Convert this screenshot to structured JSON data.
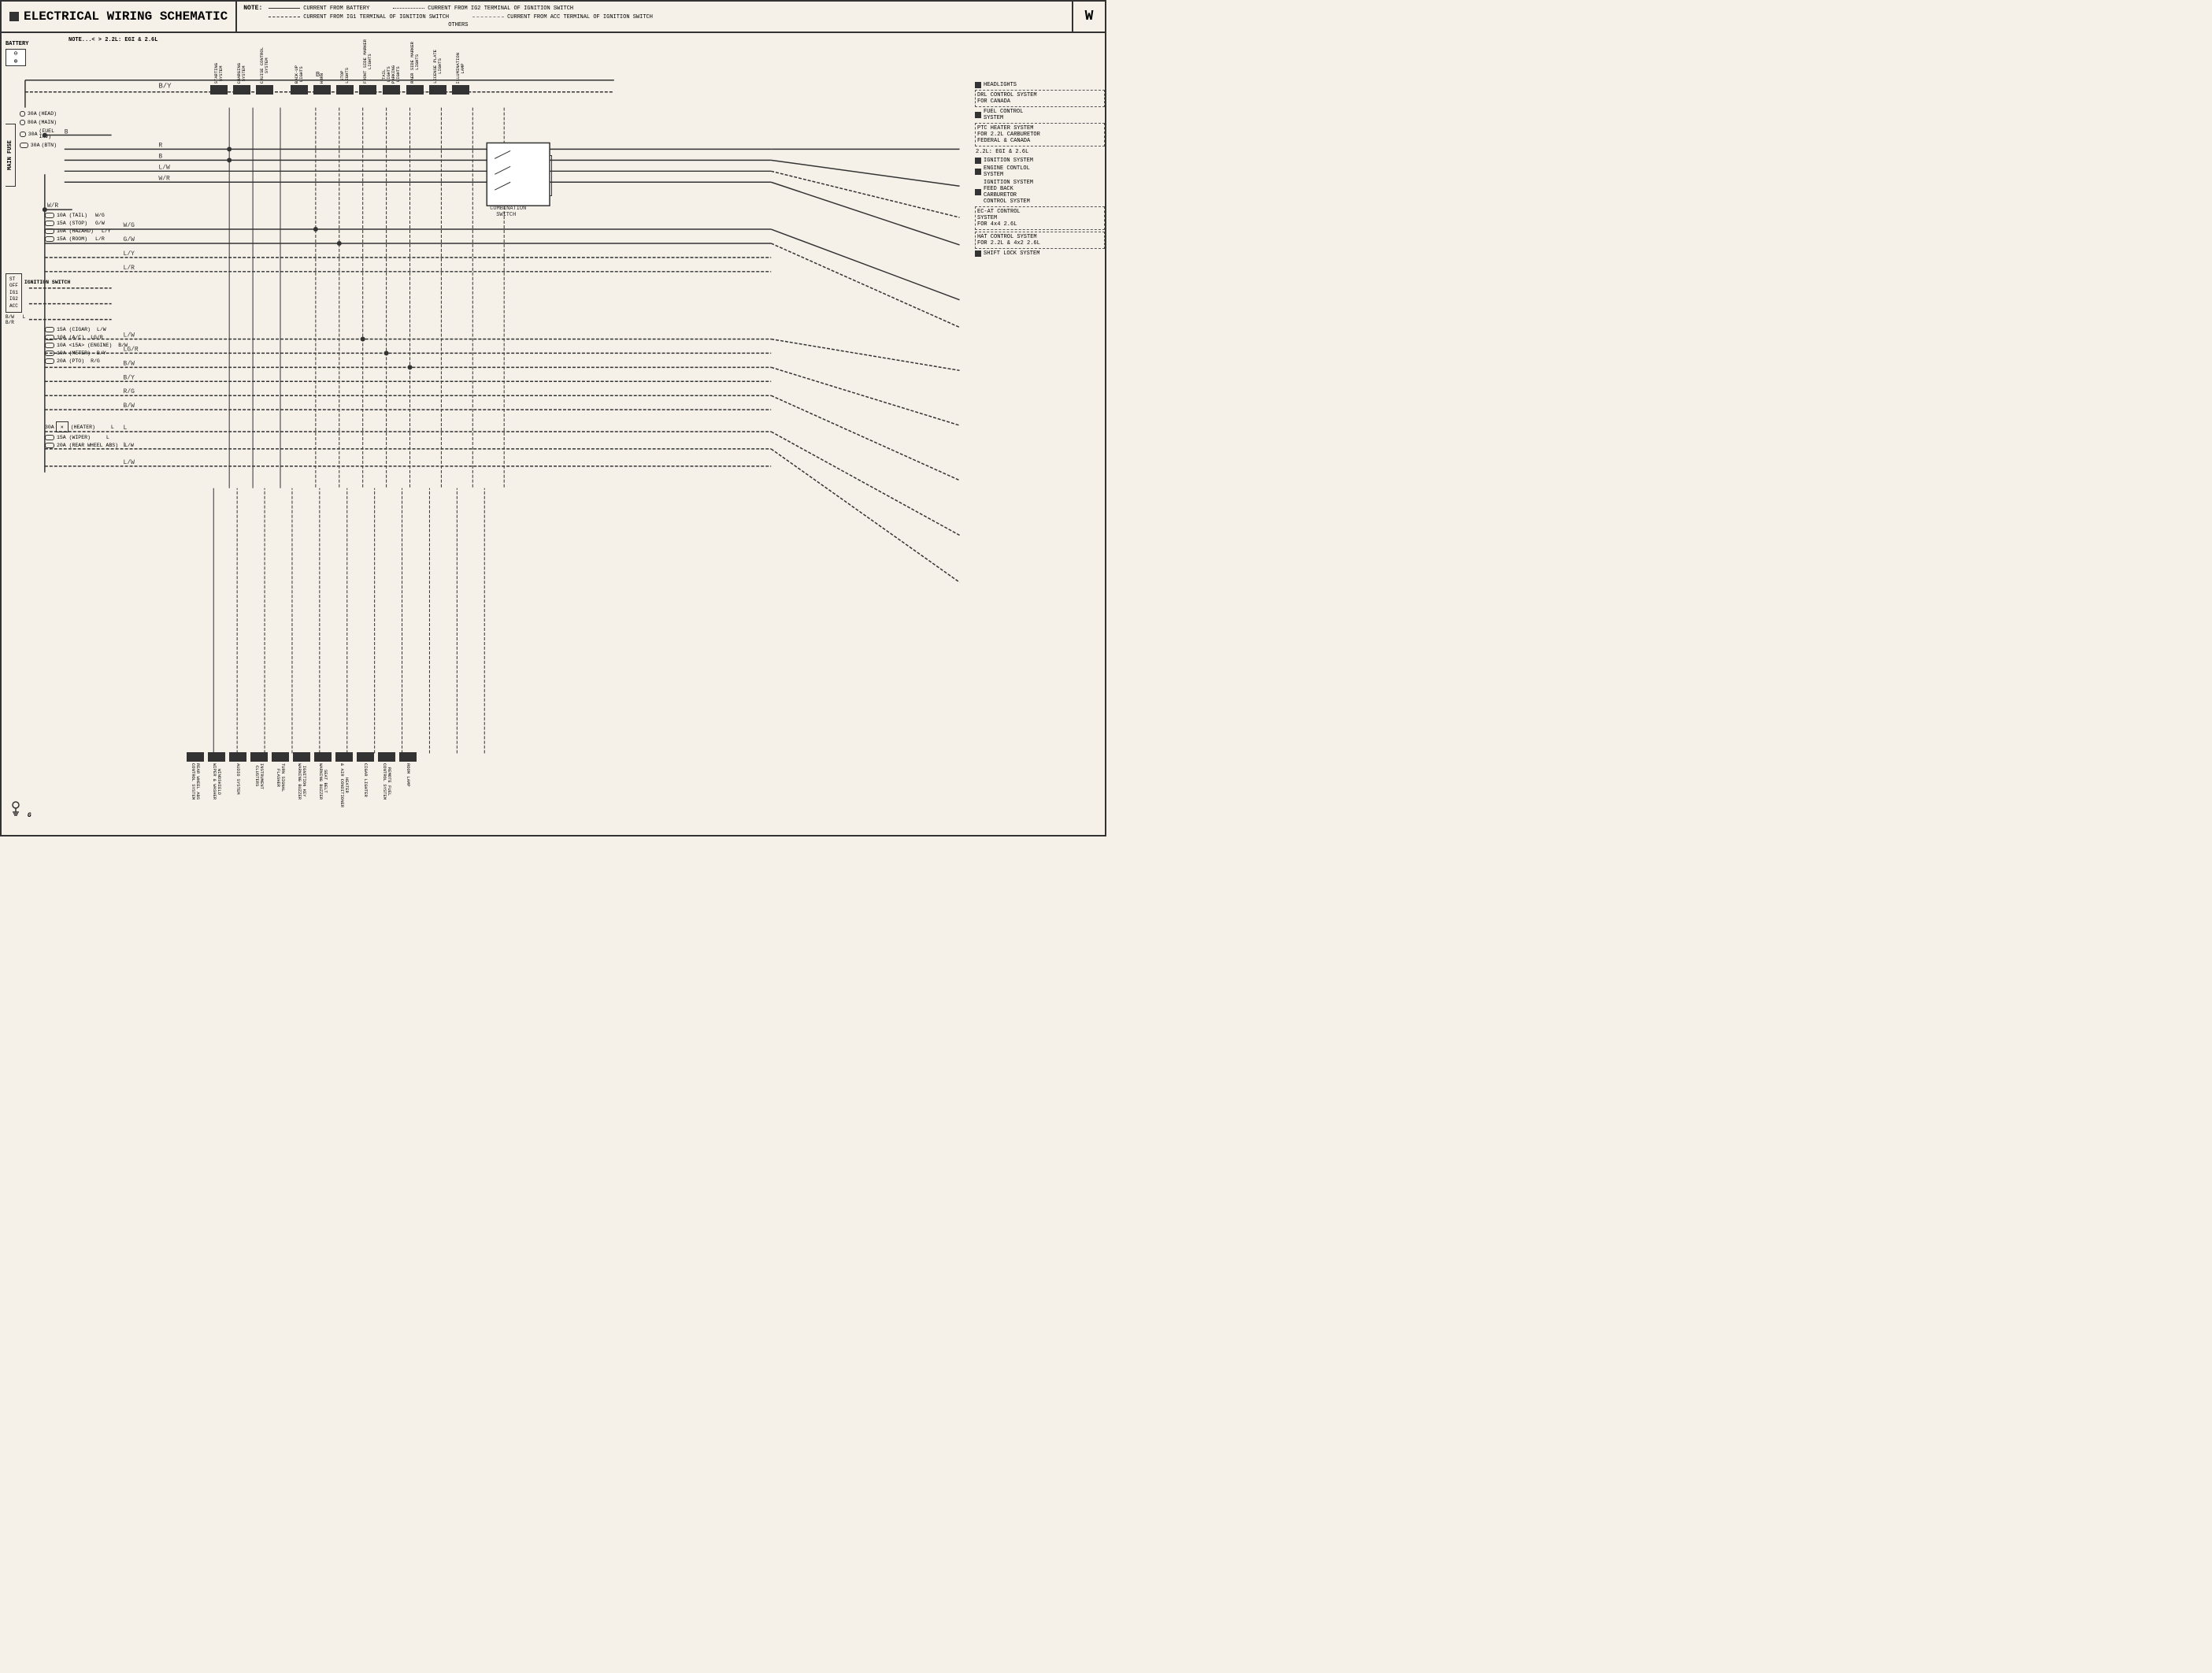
{
  "header": {
    "square": "■",
    "title": "ELECTRICAL WIRING SCHEMATIC",
    "page": "W",
    "note": {
      "label": "NOTE:",
      "lines": [
        {
          "style": "solid",
          "text": "CURRENT FROM BATTERY"
        },
        {
          "style": "dashed",
          "text": "CURRENT FROM IG1 TERMINAL OF IGNITION SWITCH"
        },
        {
          "style": "dotdash",
          "text": "CURRENT FROM IG2 TERMINAL OF IGNITION SWITCH"
        },
        {
          "style": "gray",
          "text": "CURRENT FROM ACC TERMINAL OF IGNITION SWITCH"
        },
        {
          "style": "none",
          "text": "OTHERS"
        }
      ]
    }
  },
  "battery": {
    "label": "BATTERY",
    "symbol": "⊖\n⊕"
  },
  "note_top": "NOTE...< > 2.2L: EGI & 2.6L",
  "main_fuse_label": "MAIN FUSE",
  "fuses": [
    {
      "rating": "30A",
      "label": "(HEAD)"
    },
    {
      "rating": "80A",
      "label": "(MAIN)"
    },
    {
      "rating": "30A",
      "label": "(FUEL INJ)"
    },
    {
      "rating": "30A",
      "label": "(BTN)"
    }
  ],
  "wire_labels_main": [
    "B",
    "R",
    "B",
    "L/W",
    "W/R",
    "B/Y"
  ],
  "sub_fuses": [
    {
      "rating": "10A",
      "label": "(TAIL)",
      "wire": "W/G"
    },
    {
      "rating": "15A",
      "label": "(STOP)",
      "wire": "G/W"
    },
    {
      "rating": "10A",
      "label": "(HAZARD)",
      "wire": "L/Y"
    },
    {
      "rating": "15A",
      "label": "(ROOM)",
      "wire": "L/R"
    }
  ],
  "ig_fuses": [
    {
      "rating": "15A",
      "label": "(CIGAR)",
      "wire": "L/W"
    },
    {
      "rating": "10A",
      "label": "(A/C)",
      "wire": "LG/R"
    },
    {
      "rating": "10A",
      "label": "<15A>",
      "sublabel": "(ENGINE)",
      "wire": "B/W"
    },
    {
      "rating": "10A",
      "label": "(METER)",
      "wire": "B/Y"
    },
    {
      "rating": "20A",
      "label": "(PTO)",
      "wire": "R/G"
    },
    {
      "rating": "",
      "label": "",
      "wire": "B/W"
    },
    {
      "rating": "30A",
      "label": "(HEATER)",
      "wire": "L"
    },
    {
      "rating": "15A",
      "label": "(WIPER)",
      "wire": "L"
    },
    {
      "rating": "20A",
      "label": "(REAR WHEEL ABS)",
      "wire": "L/W"
    }
  ],
  "ignition_switch": {
    "label": "IGNITION\nSWITCH",
    "positions": [
      "ST",
      "OFF",
      "IG1",
      "IG2",
      "ACC"
    ]
  },
  "top_connectors": [
    "STARTING\nSYSTEM",
    "CHARGING\nSYSTEM",
    "CRUISE CONTROL\nSYSTEM",
    "BACK-UP\nLIGHTS",
    "HORN",
    "STOP\nLIGHTS",
    "FRONT SIDE MARKER\nLIGHTS",
    "TAIL\nLIGHTS\nPARKING\nLIGHTS",
    "RAER SIDE MARKER\nLIGHTS",
    "LICENSE PLATE\nLIGHTS",
    "ILLUMINATION\nLAMP"
  ],
  "bottom_connectors": [
    "REAR WHEEL ABS\nCONTROL SYSTEM",
    "WINDSHIELD\nWIPER & WASHER",
    "AUDIO SYSTEM",
    "INSTRUMENT\nCLUSTERS",
    "TURN SIGNAL\nFLASHER",
    "IGNITION KEY\nWARNING BUZZER",
    "SEAT BELT\nWARNING BUZZER",
    "HEATER\n& AIR CONDITIONER",
    "CIGAR LIGHTER",
    "REMOTE FUEL\nCONTROL SYSTEM",
    "ROOM LAMP"
  ],
  "right_systems": [
    {
      "has_sq": true,
      "text": "HEADLIGHTS"
    },
    {
      "has_sq": false,
      "text": "DRL CONTROL SYSTEM\nFOR CANADA"
    },
    {
      "has_sq": true,
      "text": "FUEL CONTROL\nSYSTEM"
    },
    {
      "has_sq": false,
      "text": "PTC HEATER SYSTEM\nFOR 2.2L CARBURETOR\nFEDERAL & CANADA"
    },
    {
      "has_sq": false,
      "text": "2.2L: EGI & 2.6L"
    },
    {
      "has_sq": true,
      "text": "IGNITION SYSTEM"
    },
    {
      "has_sq": true,
      "text": "ENGINE CONTLOL\nSYSTEM"
    },
    {
      "has_sq": true,
      "text": "IGNITION SYSTEM\nFEED BACK\nCARBURETOR\nCONTROL SYSTEM"
    },
    {
      "has_sq": false,
      "text": "EC-AT CONTROL\nSYSTEM\nFOR 4x4 2.6L"
    },
    {
      "has_sq": false,
      "text": "HAT CONTROL SYSTEM\nFOR 2.2L & 4x2 2.6L"
    },
    {
      "has_sq": true,
      "text": "SHIFT LOCK SYSTEM"
    }
  ],
  "combination_switch": "COMBINATION\nSWITCH",
  "ground_label": "G"
}
